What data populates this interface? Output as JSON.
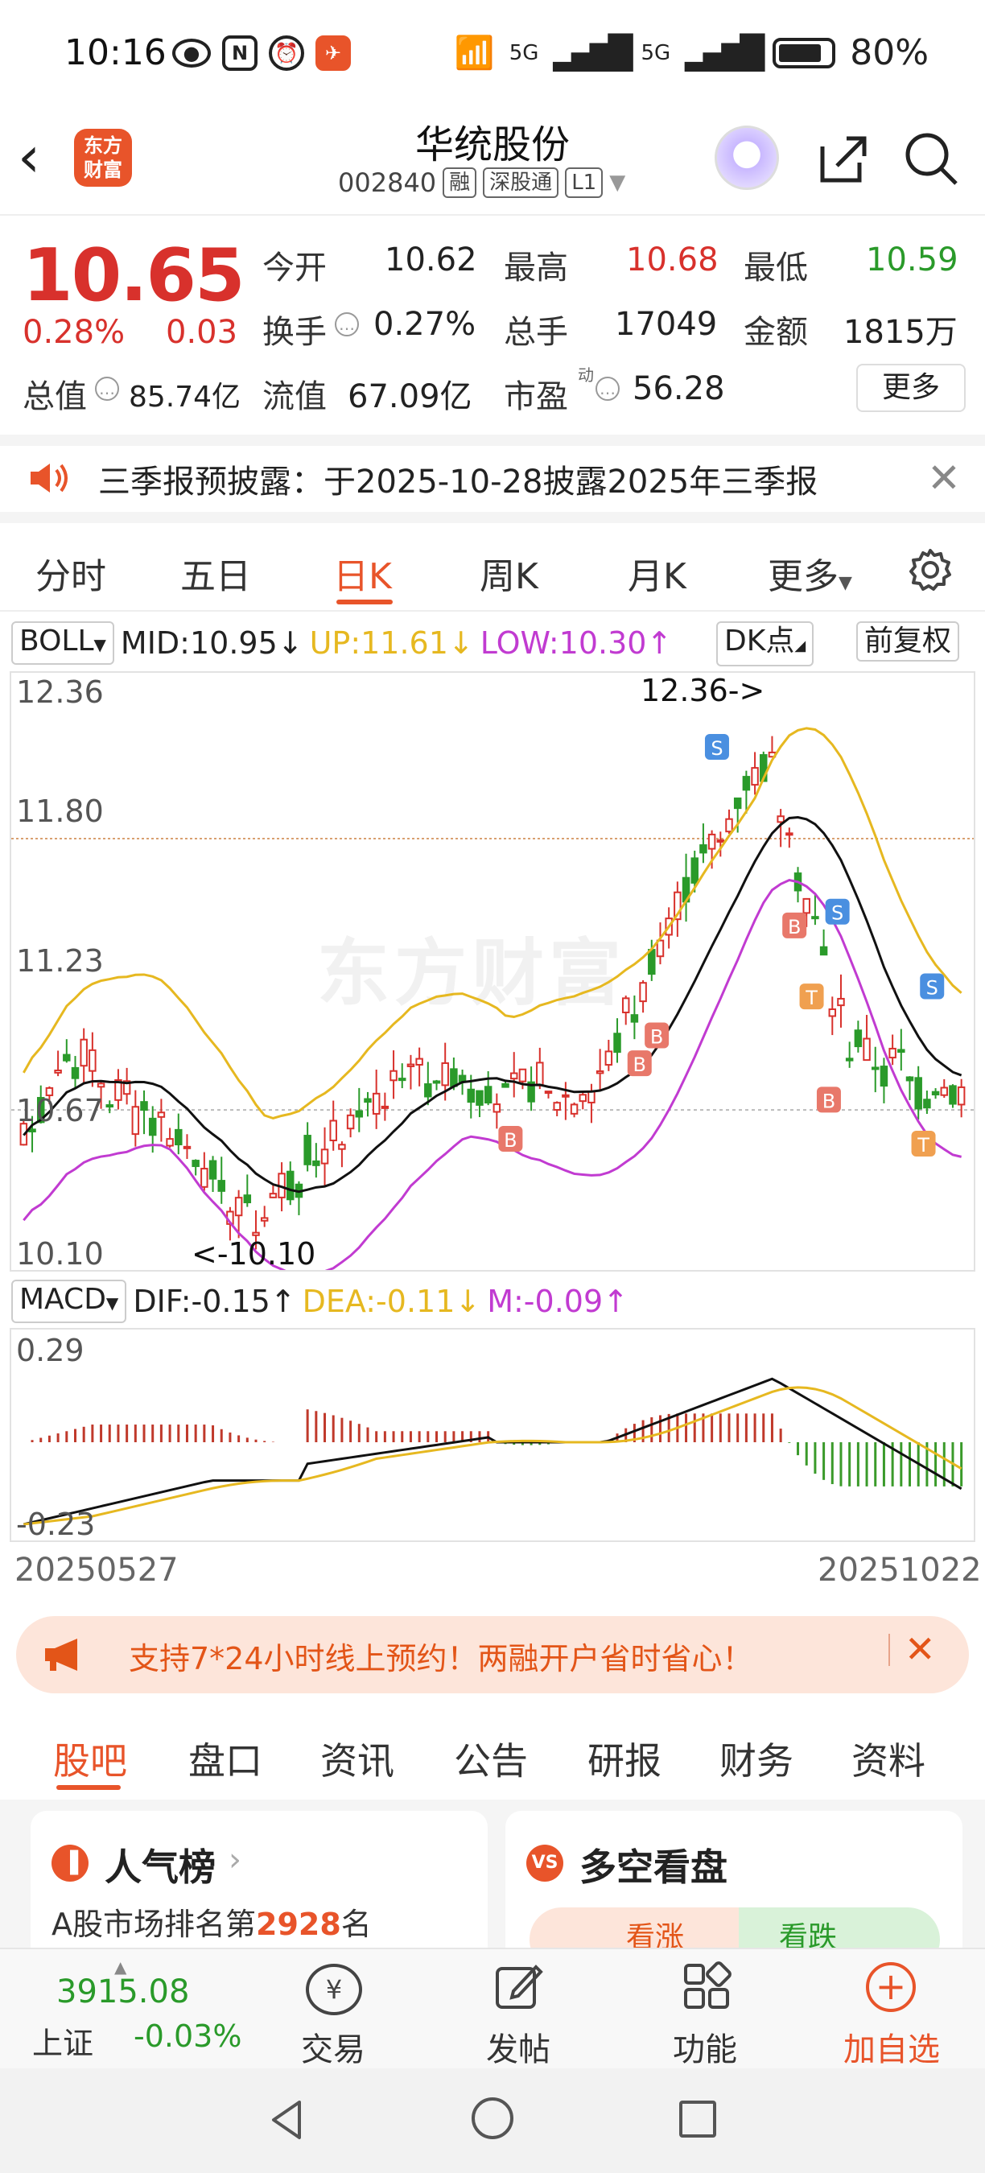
{
  "status_bar": {
    "time": "10:16",
    "battery": "80%",
    "net1": "5G",
    "net2": "5G"
  },
  "header": {
    "logo_line1": "东方",
    "logo_line2": "财富",
    "name": "华统股份",
    "code": "002840",
    "tags": [
      "融",
      "深股通",
      "L1"
    ]
  },
  "quote": {
    "price": "10.65",
    "change_pct": "0.28%",
    "change_amt": "0.03",
    "labels": {
      "open": "今开",
      "high": "最高",
      "low": "最低",
      "turnover": "换手",
      "volume": "总手",
      "amount": "金额",
      "mktcap": "总值",
      "float_cap": "流值",
      "pe": "市盈"
    },
    "values": {
      "open": "10.62",
      "high": "10.68",
      "low": "10.59",
      "turnover": "0.27%",
      "volume": "17049",
      "amount": "1815万",
      "mktcap": "85.74亿",
      "float_cap": "67.09亿",
      "pe": "56.28"
    },
    "pe_sup": "动",
    "more": "更多"
  },
  "notice": {
    "text": "三季报预披露：于2025-10-28披露2025年三季报"
  },
  "chart_tabs": [
    "分时",
    "五日",
    "日K",
    "周K",
    "月K",
    "更多"
  ],
  "boll": {
    "name": "BOLL",
    "mid": "MID:10.95↓",
    "up": "UP:11.61↓",
    "low": "LOW:10.30↑",
    "dk": "DK点",
    "adj": "前复权"
  },
  "price_axis": {
    "top": "12.36",
    "l2": "11.80",
    "l3": "11.23",
    "l4": "10.67",
    "bottom": "10.10"
  },
  "annotations": {
    "high": "12.36->",
    "low": "<-10.10"
  },
  "watermark": "东方财富",
  "macd": {
    "name": "MACD",
    "dif": "DIF:-0.15↑",
    "dea": "DEA:-0.11↓",
    "m": "M:-0.09↑",
    "top": "0.29",
    "bottom": "-0.23"
  },
  "dates": {
    "start": "20250527",
    "end": "20251022"
  },
  "promo": {
    "text": "支持7*24小时线上预约！两融开户省时省心！"
  },
  "bottom_tabs": [
    "股吧",
    "盘口",
    "资讯",
    "公告",
    "研报",
    "财务",
    "资料"
  ],
  "cards": {
    "popularity_title": "人气榜",
    "popularity_text_a": "A股市场排名第",
    "popularity_rank": "2928",
    "popularity_text_b": "名",
    "bullbear_title": "多空看盘",
    "bull": "看涨",
    "bear": "看跌"
  },
  "index": {
    "value": "3915.08",
    "name": "上证",
    "change": "-0.03%"
  },
  "nav": {
    "trade": "交易",
    "post": "发帖",
    "features": "功能",
    "add": "加自选"
  },
  "colors": {
    "accent": "#e8542a",
    "up": "#d8312c",
    "down": "#2a9a2a",
    "boll_up": "#e6b820",
    "boll_low": "#c13bd1"
  }
}
